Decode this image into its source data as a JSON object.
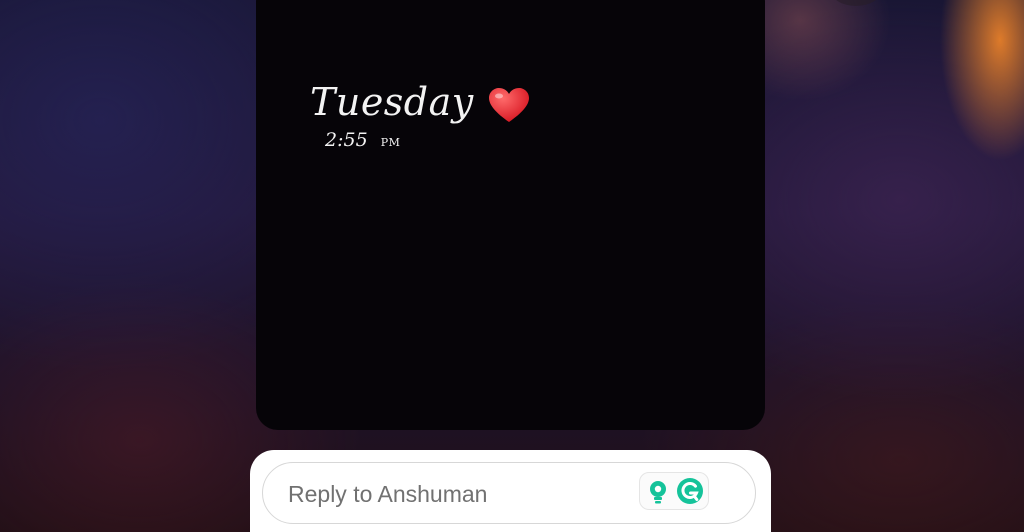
{
  "story": {
    "day": "Tuesday",
    "time": "2:55",
    "ampm": "PM"
  },
  "reply": {
    "placeholder": "Reply to Anshuman"
  },
  "icons": {
    "heart": "heart-icon",
    "bulb": "lightbulb-icon",
    "grammarly": "grammarly-icon"
  },
  "colors": {
    "heart": "#e8202a",
    "grammarly": "#15c39a"
  }
}
